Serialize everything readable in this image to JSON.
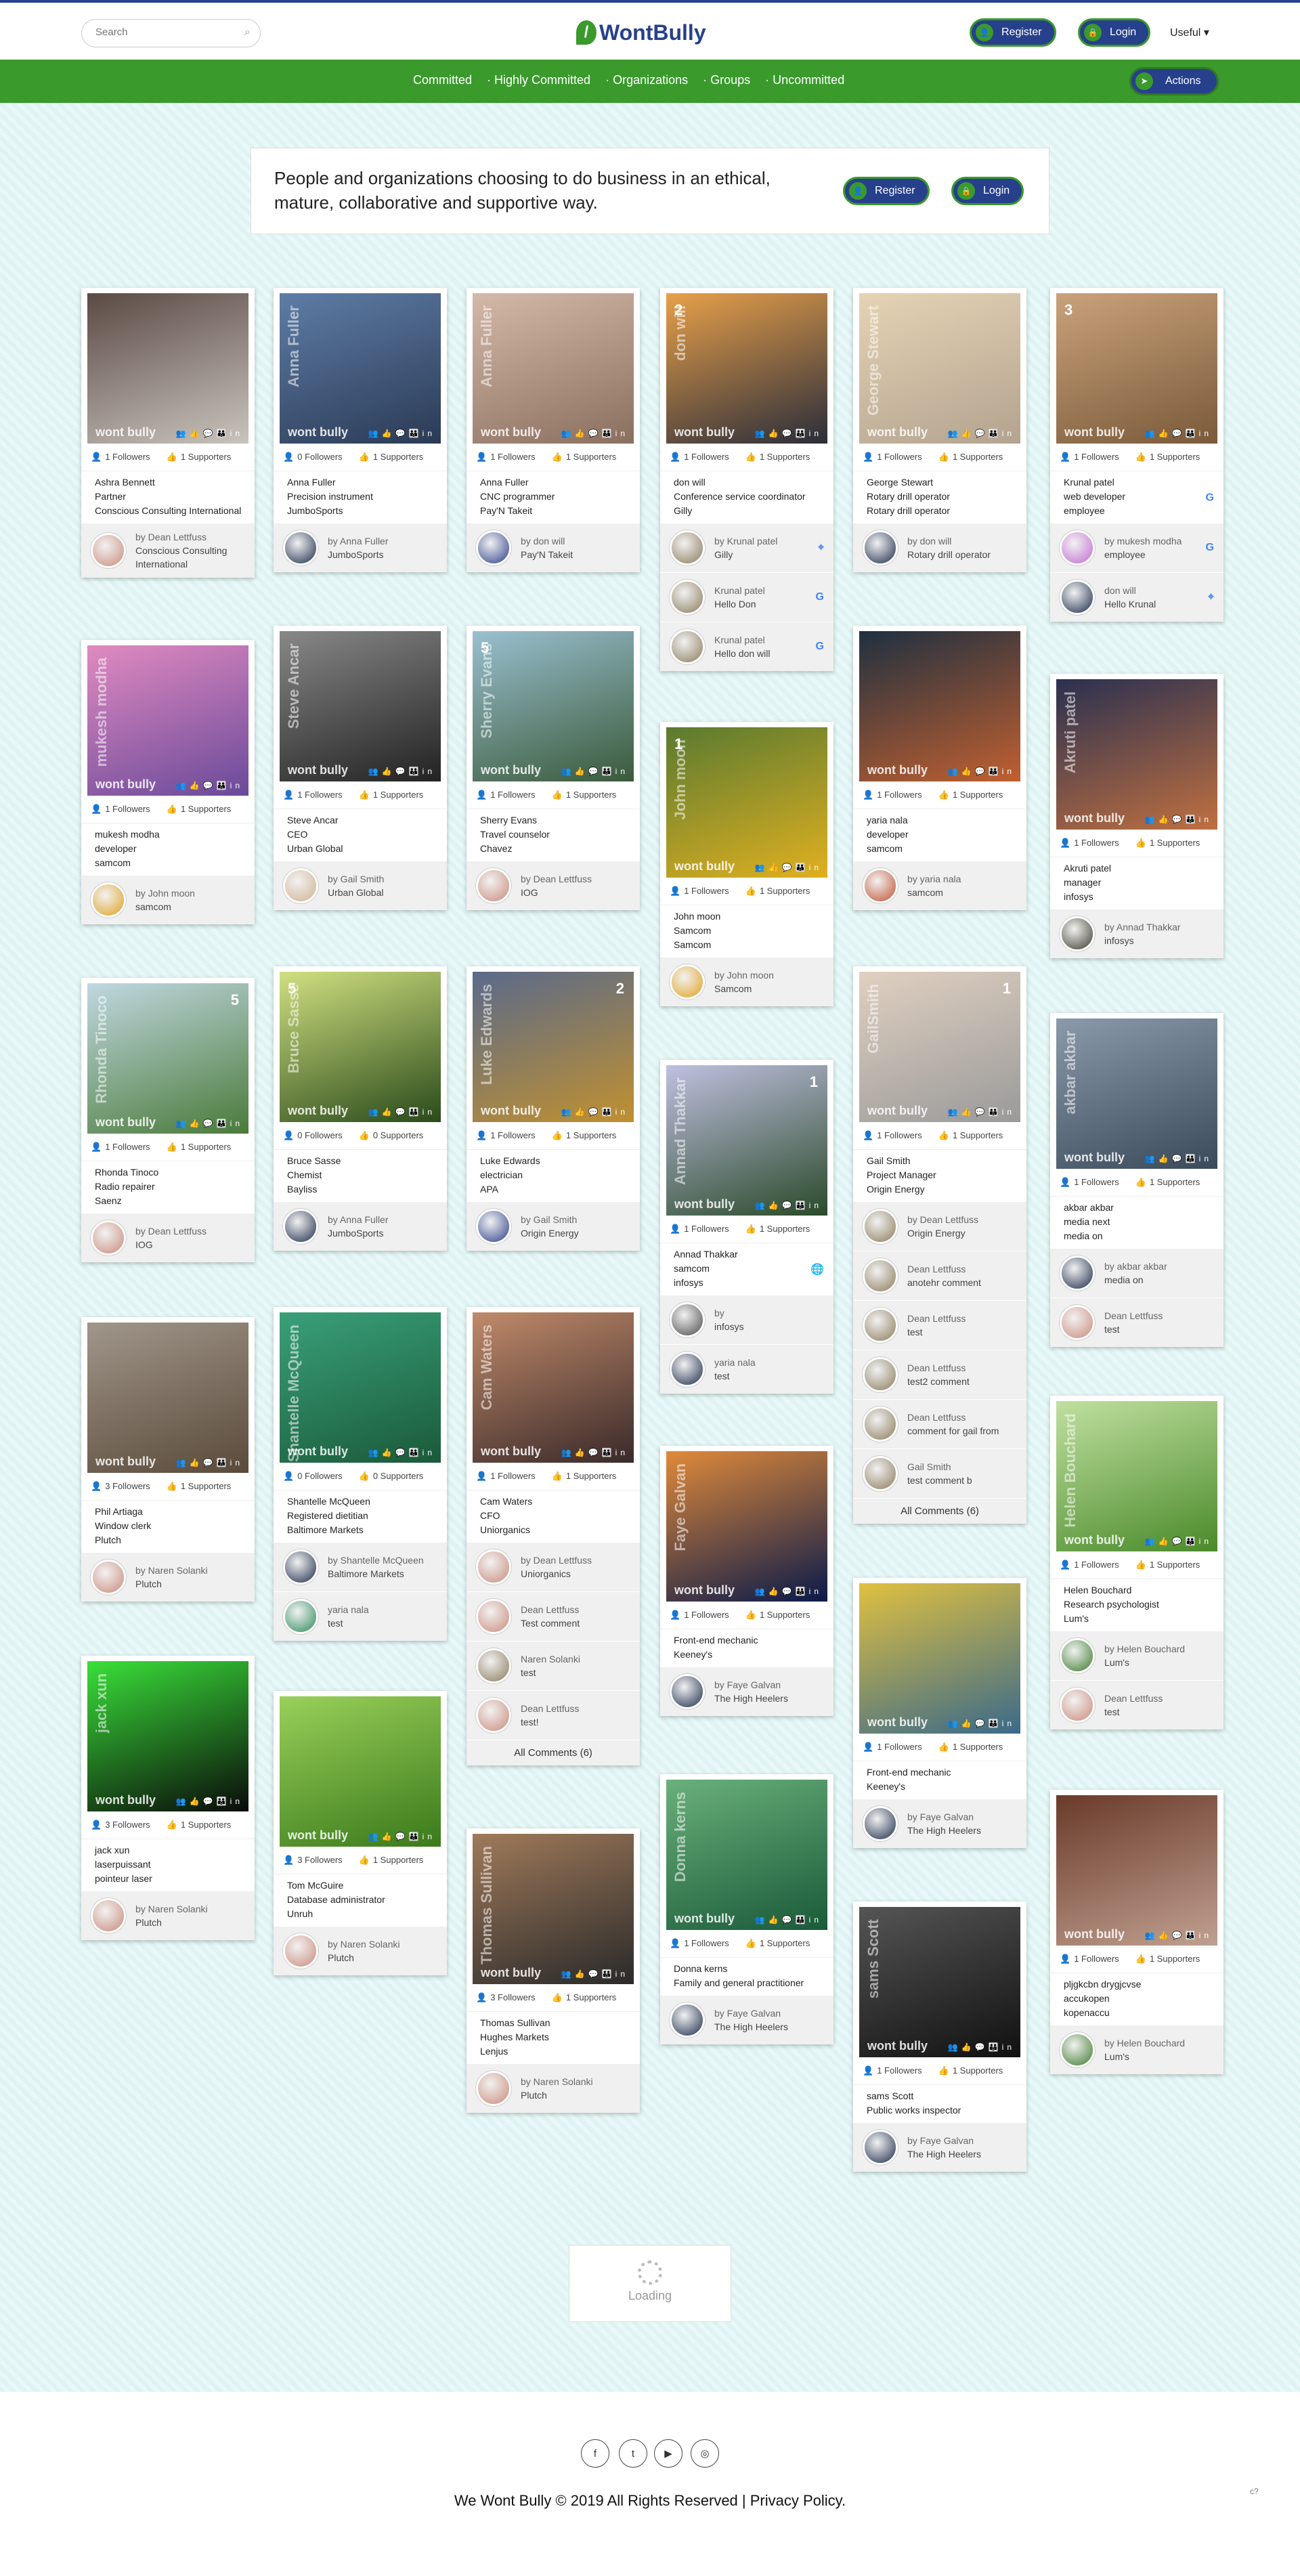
{
  "search": {
    "placeholder": "Search"
  },
  "brand": {
    "name": "WontBully",
    "leaf": "/"
  },
  "header": {
    "register": "Register",
    "login": "Login",
    "useful": "Useful"
  },
  "nav": {
    "items": [
      "Committed",
      "· Highly Committed",
      "· Organizations",
      "· Groups",
      "· Uncommitted"
    ],
    "actions": "Actions"
  },
  "hero": {
    "text": "People and organizations choosing to do business in an ethical, mature, collaborative and supportive way.",
    "register": "Register",
    "login": "Login"
  },
  "card_brand": "wont bully",
  "cards": [
    {
      "name": "Ashra Bennett",
      "role": "Partner",
      "org": "Conscious Consulting International",
      "followers": "1 Followers",
      "supporters": "1 Supporters",
      "vname": "",
      "num": "",
      "img": [
        "#c9c4bd",
        "#5b4a44"
      ],
      "comments": [
        {
          "l1": "by Dean Lettfuss",
          "l2": "Conscious Consulting International",
          "av": "#c98a7a"
        }
      ]
    },
    {
      "name": "Anna Fuller",
      "role": "Precision instrument",
      "org": "JumboSports",
      "followers": "0 Followers",
      "supporters": "1 Supporters",
      "vname": "Anna Fuller",
      "num": "",
      "img": [
        "#2b3a55",
        "#5e7da6"
      ],
      "comments": [
        {
          "l1": "by Anna Fuller",
          "l2": "JumboSports",
          "av": "#1c2b4a"
        }
      ]
    },
    {
      "name": "Anna Fuller",
      "role": "CNC programmer",
      "org": "Pay'N Takeit",
      "followers": "1 Followers",
      "supporters": "1 Supporters",
      "vname": "Anna Fuller",
      "num": "",
      "img": [
        "#8a6f5f",
        "#d4b8a8"
      ],
      "comments": [
        {
          "l1": "by don will",
          "l2": "Pay'N Takeit",
          "av": "#2c3e8a"
        }
      ]
    },
    {
      "name": "don will",
      "role": "Conference service coordinator",
      "org": "Gilly",
      "followers": "1 Followers",
      "supporters": "1 Supporters",
      "vname": "don will",
      "num": "2",
      "img": [
        "#2a2d3a",
        "#e8a04a"
      ],
      "comments": [
        {
          "l1": "by Krunal patel",
          "l2": "Gilly",
          "av": "#8a7a5a",
          "badge": "⌖"
        },
        {
          "l1": "Krunal patel",
          "l2": "Hello Don",
          "av": "#8a7a5a",
          "badge": "G"
        },
        {
          "l1": "Krunal patel",
          "l2": "Hello don will",
          "av": "#8a7a5a",
          "badge": "G"
        }
      ]
    },
    {
      "name": "George Stewart",
      "role": "Rotary drill operator",
      "org": "Rotary drill operator",
      "followers": "1 Followers",
      "supporters": "1 Supporters",
      "vname": "George Stewart",
      "num": "",
      "img": [
        "#b3a38f",
        "#e6d3b5"
      ],
      "comments": [
        {
          "l1": "by don will",
          "l2": "Rotary drill operator",
          "av": "#1c2b4a"
        }
      ]
    },
    {
      "name": "Krunal patel",
      "role": "web developer",
      "org": "employee",
      "followers": "1 Followers",
      "supporters": "1 Supporters",
      "vname": "",
      "num": "3",
      "img": [
        "#7a5a3a",
        "#c9a27a"
      ],
      "badge": "G",
      "comments": [
        {
          "l1": "by mukesh modha",
          "l2": "employee",
          "av": "#c06ad0",
          "badge": "G"
        },
        {
          "l1": "don will",
          "l2": "Hello Krunal",
          "av": "#1c2b4a",
          "badge": "⌖"
        }
      ]
    },
    {
      "name": "mukesh modha",
      "role": "developer",
      "org": "samcom",
      "followers": "1 Followers",
      "supporters": "1 Supporters",
      "vname": "mukesh modha",
      "num": "",
      "img": [
        "#6a4a9a",
        "#e08ac0"
      ],
      "comments": [
        {
          "l1": "by John moon",
          "l2": "samcom",
          "av": "#e0a020"
        }
      ]
    },
    {
      "name": "Steve Ancar",
      "role": "CEO",
      "org": "Urban Global",
      "followers": "1 Followers",
      "supporters": "1 Supporters",
      "vname": "Steve Ancar",
      "num": "",
      "img": [
        "#222",
        "#888"
      ],
      "comments": [
        {
          "l1": "by Gail Smith",
          "l2": "Urban Global",
          "av": "#d0b090"
        }
      ]
    },
    {
      "name": "Sherry Evans",
      "role": "Travel counselor",
      "org": "Chavez",
      "followers": "1 Followers",
      "supporters": "1 Supporters",
      "vname": "Sherry Evans",
      "num": "5",
      "img": [
        "#3a5a3a",
        "#9ac0d0"
      ],
      "comments": [
        {
          "l1": "by Dean Lettfuss",
          "l2": "IOG",
          "av": "#c98a7a"
        }
      ]
    },
    {
      "name": "John moon",
      "role": "Samcom",
      "org": "Samcom",
      "followers": "1 Followers",
      "supporters": "1 Supporters",
      "vname": "John moon",
      "num": "1",
      "img": [
        "#e0b020",
        "#5a7a30"
      ],
      "comments": [
        {
          "l1": "by John moon",
          "l2": "Samcom",
          "av": "#e0a020"
        }
      ]
    },
    {
      "name": "yaria nala",
      "role": "developer",
      "org": "samcom",
      "followers": "1 Followers",
      "supporters": "1 Supporters",
      "vname": "",
      "num": "",
      "img": [
        "#c06030",
        "#203040"
      ],
      "comments": [
        {
          "l1": "by yaria nala",
          "l2": "samcom",
          "av": "#c05030"
        }
      ]
    },
    {
      "name": "Akruti patel",
      "role": "manager",
      "org": "infosys",
      "followers": "1 Followers",
      "supporters": "1 Supporters",
      "vname": "Akruti patel",
      "num": "",
      "img": [
        "#c07040",
        "#2a3050"
      ],
      "comments": [
        {
          "l1": "by Annad Thakkar",
          "l2": "infosys",
          "av": "#3a3a2a"
        }
      ]
    },
    {
      "name": "Rhonda Tinoco",
      "role": "Radio repairer",
      "org": "Saenz",
      "followers": "1 Followers",
      "supporters": "1 Supporters",
      "vname": "Rhonda Tinoco",
      "num": "5",
      "img": [
        "#4a7a3a",
        "#c0d8e0"
      ],
      "comments": [
        {
          "l1": "by Dean Lettfuss",
          "l2": "IOG",
          "av": "#c98a7a"
        }
      ]
    },
    {
      "name": "Bruce Sasse",
      "role": "Chemist",
      "org": "Bayliss",
      "followers": "0 Followers",
      "supporters": "0 Supporters",
      "vname": "Bruce Sasse",
      "num": "5",
      "img": [
        "#2a4a1a",
        "#d0e080"
      ],
      "comments": [
        {
          "l1": "by Anna Fuller",
          "l2": "JumboSports",
          "av": "#1c2b4a"
        }
      ]
    },
    {
      "name": "Luke Edwards",
      "role": "electrician",
      "org": "APA",
      "followers": "1 Followers",
      "supporters": "1 Supporters",
      "vname": "Luke Edwards",
      "num": "2",
      "img": [
        "#c09030",
        "#5a6a8a"
      ],
      "comments": [
        {
          "l1": "by Gail Smith",
          "l2": "Origin Energy",
          "av": "#2c3e8a"
        }
      ]
    },
    {
      "name": "Annad Thakkar",
      "role": "samcom",
      "org": "infosys",
      "followers": "1 Followers",
      "supporters": "1 Supporters",
      "vname": "Annad Thakkar",
      "num": "1",
      "img": [
        "#2a4a2a",
        "#c0c0e0"
      ],
      "badge": "🌐",
      "comments": [
        {
          "l1": "by",
          "l2": "infosys",
          "av": "#4a4a4a"
        },
        {
          "l1": "yaria nala",
          "l2": "test",
          "av": "#1c2b4a"
        }
      ]
    },
    {
      "name": "Gail Smith",
      "role": "Project Manager",
      "org": "Origin Energy",
      "followers": "1 Followers",
      "supporters": "1 Supporters",
      "vname": "GailSmith",
      "num": "1",
      "img": [
        "#9a9a9a",
        "#e0d0c0"
      ],
      "comments": [
        {
          "l1": "by Dean Lettfuss",
          "l2": "Origin Energy",
          "av": "#8a7a5a"
        },
        {
          "l1": "Dean Lettfuss",
          "l2": "anotehr comment",
          "av": "#8a7a5a"
        },
        {
          "l1": "Dean Lettfuss",
          "l2": "test",
          "av": "#8a7a5a"
        },
        {
          "l1": "Dean Lettfuss",
          "l2": "test2 comment",
          "av": "#8a7a5a"
        },
        {
          "l1": "Dean Lettfuss",
          "l2": "comment for gail from",
          "av": "#8a7a5a"
        },
        {
          "l1": "Gail Smith",
          "l2": "test comment b",
          "av": "#8a7a5a"
        }
      ],
      "all": "All Comments (6)"
    },
    {
      "name": "akbar akbar",
      "role": "media next",
      "org": "media on",
      "followers": "1 Followers",
      "supporters": "1 Supporters",
      "vname": "akbar akbar",
      "num": "",
      "img": [
        "#3a4a5a",
        "#8a9aaa"
      ],
      "comments": [
        {
          "l1": "by akbar akbar",
          "l2": "media on",
          "av": "#1c2b4a"
        },
        {
          "l1": "Dean Lettfuss",
          "l2": "test",
          "av": "#c98a7a"
        }
      ]
    },
    {
      "name": "Phil Artiaga",
      "role": "Window clerk",
      "org": "Plutch",
      "followers": "3 Followers",
      "supporters": "1 Supporters",
      "vname": "",
      "num": "",
      "img": [
        "#5a4a3a",
        "#a0968a"
      ],
      "comments": [
        {
          "l1": "by Naren Solanki",
          "l2": "Plutch",
          "av": "#c98a7a"
        }
      ]
    },
    {
      "name": "Shantelle McQueen",
      "role": "Registered dietitian",
      "org": "Baltimore Markets",
      "followers": "0 Followers",
      "supporters": "0 Supporters",
      "vname": "Shantelle McQueen",
      "num": "",
      "img": [
        "#1a5a3a",
        "#3aa07a"
      ],
      "comments": [
        {
          "l1": "by Shantelle McQueen",
          "l2": "Baltimore Markets",
          "av": "#1c2b4a"
        },
        {
          "l1": "yaria nala",
          "l2": "test",
          "av": "#2a8a5a"
        }
      ]
    },
    {
      "name": "Cam Waters",
      "role": "CFO",
      "org": "Uniorganics",
      "followers": "1 Followers",
      "supporters": "1 Supporters",
      "vname": "Cam Waters",
      "num": "",
      "img": [
        "#3a2a2a",
        "#c08a6a"
      ],
      "comments": [
        {
          "l1": "by Dean Lettfuss",
          "l2": "Uniorganics",
          "av": "#c98a7a"
        },
        {
          "l1": "Dean Lettfuss",
          "l2": "Test comment",
          "av": "#c98a7a"
        },
        {
          "l1": "Naren Solanki",
          "l2": "test",
          "av": "#8a7a5a"
        },
        {
          "l1": "Dean Lettfuss",
          "l2": "test!",
          "av": "#c98a7a"
        }
      ],
      "all": "All Comments (6)"
    },
    {
      "name": "Front-end mechanic",
      "role": "Keeney's",
      "org": "",
      "followers": "1 Followers",
      "supporters": "1 Supporters",
      "vname": "Faye Galvan",
      "num": "",
      "img": [
        "#0a1a4a",
        "#e08a3a"
      ],
      "comments": [
        {
          "l1": "by Faye Galvan",
          "l2": "The High Heelers",
          "av": "#1c2b4a"
        }
      ]
    },
    {
      "name": "Front-end mechanic",
      "role": "Keeney's",
      "org": "",
      "followers": "1 Followers",
      "supporters": "1 Supporters",
      "vname": "",
      "num": "",
      "img": [
        "#3a6a8a",
        "#e0c040"
      ],
      "comments": [
        {
          "l1": "by Faye Galvan",
          "l2": "The High Heelers",
          "av": "#1c2b4a"
        }
      ]
    },
    {
      "name": "Helen Bouchard",
      "role": "Research psychologist",
      "org": "Lum's",
      "followers": "1 Followers",
      "supporters": "1 Supporters",
      "vname": "Helen Bouchard",
      "num": "",
      "img": [
        "#4a8a2a",
        "#c0e0a0"
      ],
      "comments": [
        {
          "l1": "by Helen Bouchard",
          "l2": "Lum's",
          "av": "#3a7a2a"
        },
        {
          "l1": "Dean Lettfuss",
          "l2": "test",
          "av": "#c98a7a"
        }
      ]
    },
    {
      "name": "jack xun",
      "role": "laserpuissant",
      "org": "pointeur laser",
      "followers": "3 Followers",
      "supporters": "1 Supporters",
      "vname": "jack xun",
      "num": "",
      "img": [
        "#0a0a0a",
        "#3ae03a"
      ],
      "comments": [
        {
          "l1": "by Naren Solanki",
          "l2": "Plutch",
          "av": "#c98a7a"
        }
      ]
    },
    {
      "name": "Tom McGuire",
      "role": "Database administrator",
      "org": "Unruh",
      "followers": "3 Followers",
      "supporters": "1 Supporters",
      "vname": "",
      "num": "",
      "img": [
        "#3a7a1a",
        "#9ad05a"
      ],
      "comments": [
        {
          "l1": "by Naren Solanki",
          "l2": "Plutch",
          "av": "#c98a7a"
        }
      ]
    },
    {
      "name": "Thomas Sullivan",
      "role": "Hughes Markets",
      "org": "Lenjus",
      "followers": "3 Followers",
      "supporters": "1 Supporters",
      "vname": "Thomas Sullivan",
      "num": "",
      "img": [
        "#2a2a2a",
        "#a07a5a"
      ],
      "comments": [
        {
          "l1": "by Naren Solanki",
          "l2": "Plutch",
          "av": "#c98a7a"
        }
      ]
    },
    {
      "name": "Donna kerns",
      "role": "Family and general practitioner",
      "org": "",
      "followers": "1 Followers",
      "supporters": "1 Supporters",
      "vname": "Donna kerns",
      "num": "",
      "img": [
        "#1a5a3a",
        "#6ab07a"
      ],
      "comments": [
        {
          "l1": "by Faye Galvan",
          "l2": "The High Heelers",
          "av": "#1c2b4a"
        }
      ]
    },
    {
      "name": "sams Scott",
      "role": "Public works inspector",
      "org": "",
      "followers": "1 Followers",
      "supporters": "1 Supporters",
      "vname": "sams Scott",
      "num": "",
      "img": [
        "#111",
        "#555"
      ],
      "comments": [
        {
          "l1": "by Faye Galvan",
          "l2": "The High Heelers",
          "av": "#1c2b4a"
        }
      ]
    },
    {
      "name": "pljgkcbn drygjcvse",
      "role": "accukopen",
      "org": "kopenaccu",
      "followers": "1 Followers",
      "supporters": "1 Supporters",
      "vname": "",
      "num": "",
      "img": [
        "#c0a090",
        "#6a3a2a"
      ],
      "comments": [
        {
          "l1": "by Helen Bouchard",
          "l2": "Lum's",
          "av": "#3a7a2a"
        }
      ]
    }
  ],
  "loading": "Loading",
  "footer": {
    "social": [
      "f",
      "t",
      "▶",
      "◎"
    ],
    "copyright": "We Wont Bully © 2019 All Rights Reserved | Privacy Policy.",
    "corner": "c?"
  }
}
